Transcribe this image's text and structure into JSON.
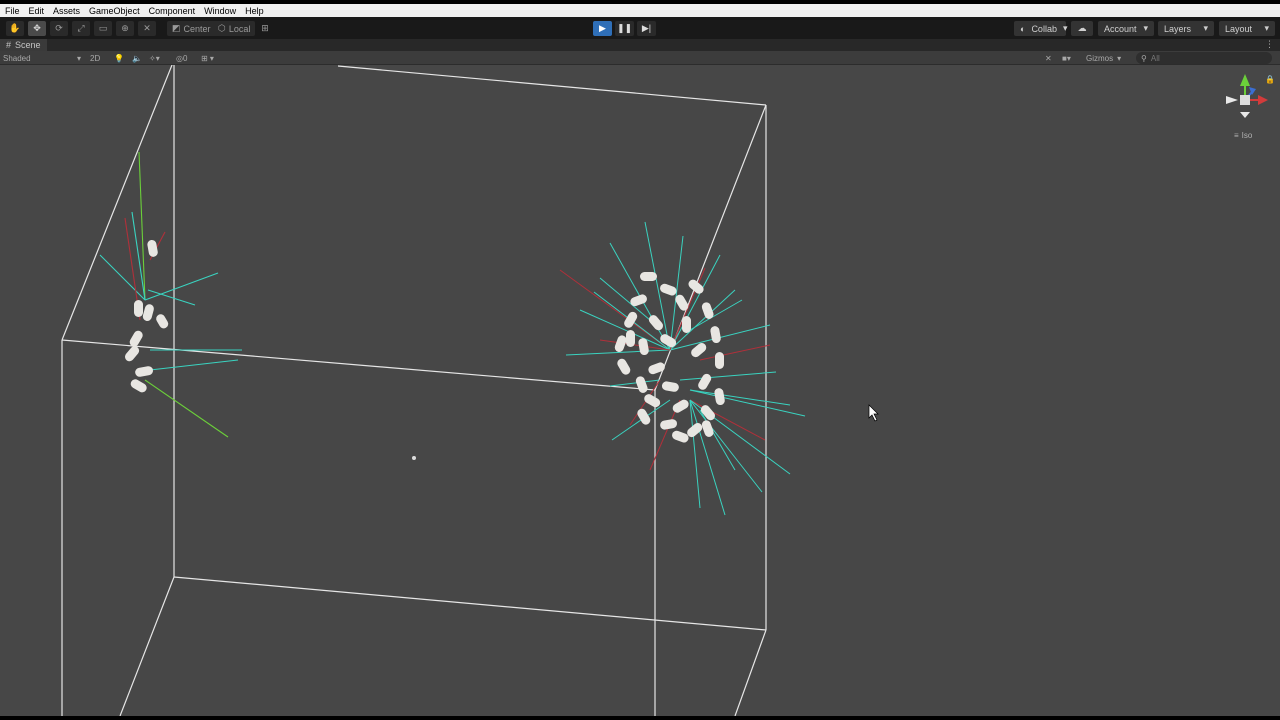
{
  "menu": [
    "File",
    "Edit",
    "Assets",
    "GameObject",
    "Component",
    "Window",
    "Help"
  ],
  "toolbar": {
    "tools": [
      "hand-tool-icon",
      "move-tool-icon",
      "rotate-tool-icon",
      "scale-tool-icon",
      "rect-tool-icon",
      "transform-tool-icon",
      "custom-tool-icon"
    ],
    "pivot_label": "Center",
    "space_label": "Local",
    "collab_label": "Collab",
    "account_label": "Account",
    "layers_label": "Layers",
    "layout_label": "Layout"
  },
  "scene_tab": {
    "label": "Scene"
  },
  "scene_toolbar": {
    "draw_mode": "Shaded",
    "mode_2d": "2D",
    "hidden_count": "0",
    "gizmos_label": "Gizmos",
    "search_placeholder": "All"
  },
  "gizmo": {
    "projection_label": "Iso"
  },
  "colors": {
    "viewport_bg": "#474747",
    "play_active": "#2f6fb8",
    "ray_cyan": "#3ad3c0",
    "ray_red": "#b0303a",
    "ray_green": "#6bcf3a",
    "agent_white": "#e8e6e2",
    "box_line": "#e6e6e6"
  }
}
